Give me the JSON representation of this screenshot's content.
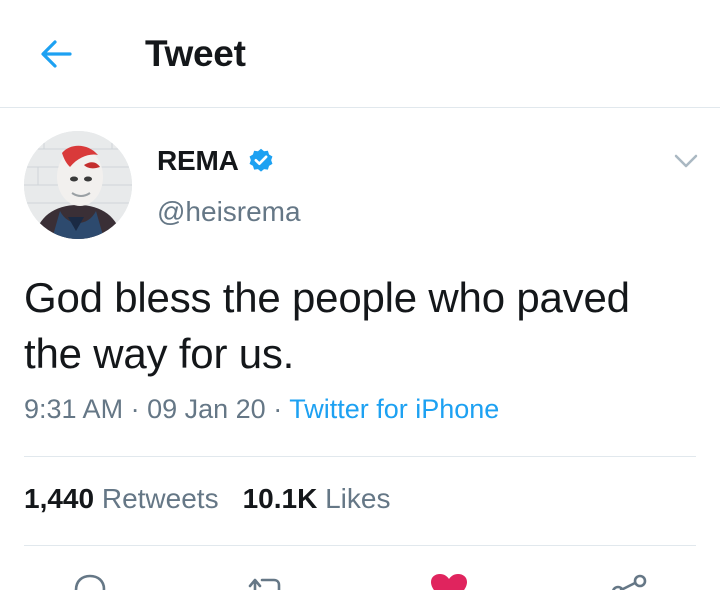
{
  "header": {
    "title": "Tweet",
    "back_icon": "arrow-left-icon",
    "accent_color": "#1da1f2"
  },
  "tweet": {
    "author": {
      "display_name": "REMA",
      "handle": "@heisrema",
      "verified": true,
      "verified_icon": "verified-badge-icon"
    },
    "text": "God bless the people who paved the way for us.",
    "time": "9:31 AM",
    "date": "09 Jan 20",
    "separator": "·",
    "source": "Twitter for iPhone"
  },
  "stats": {
    "retweets_count": "1,440",
    "retweets_label": "Retweets",
    "likes_count": "10.1K",
    "likes_label": "Likes"
  },
  "actions": [
    {
      "icon": "reply-icon"
    },
    {
      "icon": "retweet-icon"
    },
    {
      "icon": "heart-icon",
      "active": true,
      "color": "#e0245e"
    },
    {
      "icon": "share-icon"
    }
  ]
}
